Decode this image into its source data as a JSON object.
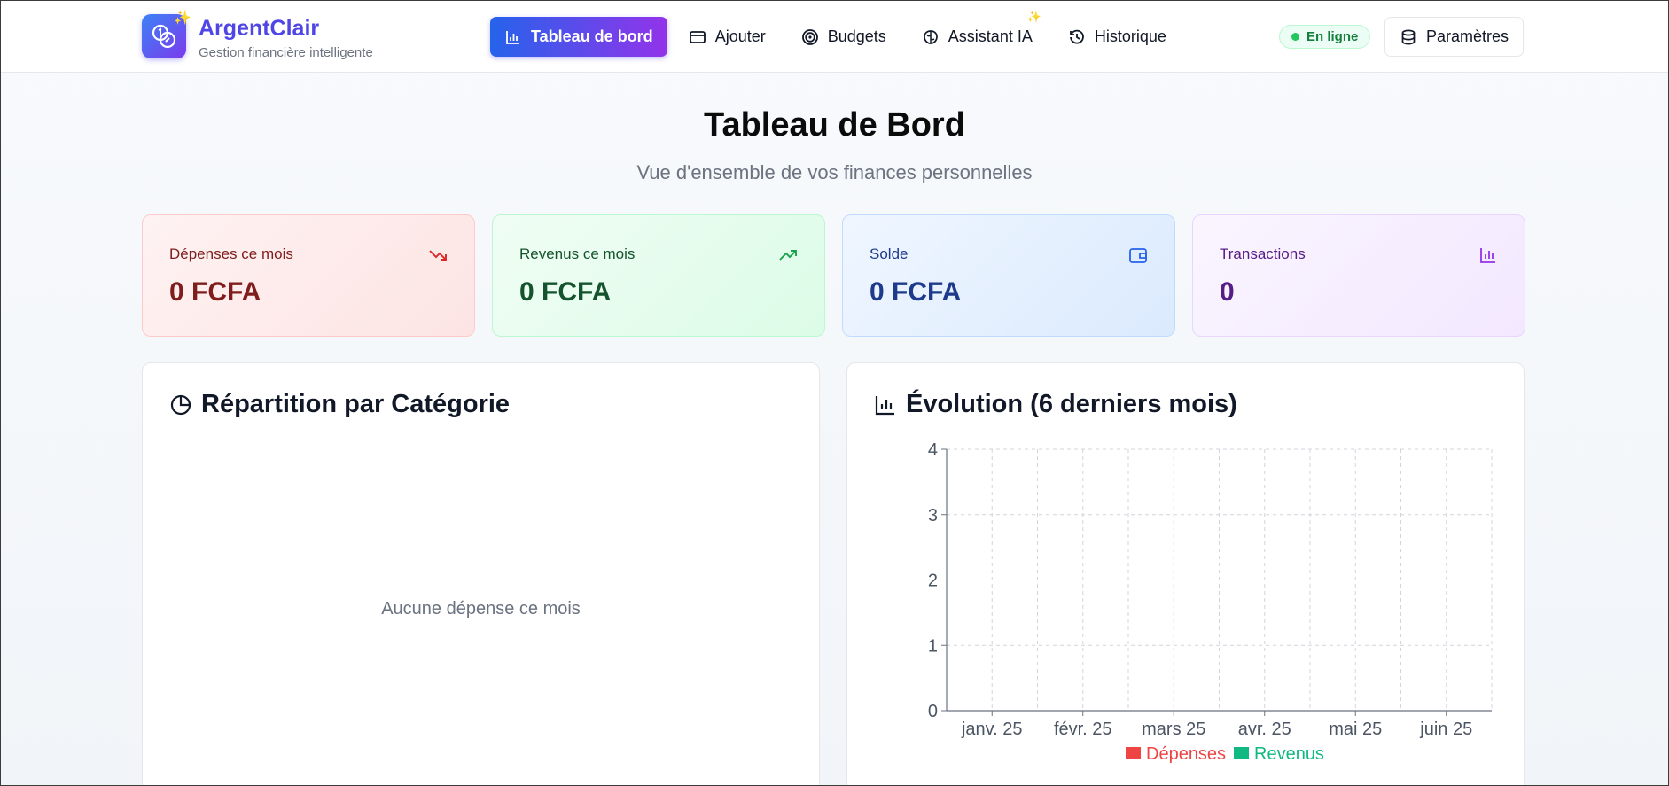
{
  "app": {
    "name": "ArgentClair",
    "subtitle": "Gestion financière intelligente"
  },
  "nav": {
    "items": [
      {
        "label": "Tableau de bord",
        "icon": "bar-chart-icon",
        "active": true
      },
      {
        "label": "Ajouter",
        "icon": "credit-card-icon",
        "active": false
      },
      {
        "label": "Budgets",
        "icon": "target-icon",
        "active": false
      },
      {
        "label": "Assistant IA",
        "icon": "brain-icon",
        "active": false,
        "badge": "sparkle-icon"
      },
      {
        "label": "Historique",
        "icon": "history-icon",
        "active": false
      }
    ]
  },
  "status": {
    "label": "En ligne",
    "color": "#22c55e"
  },
  "settings": {
    "label": "Paramètres",
    "icon": "database-icon"
  },
  "page": {
    "title": "Tableau de Bord",
    "subtitle": "Vue d'ensemble de vos finances personnelles"
  },
  "stats": [
    {
      "label": "Dépenses ce mois",
      "value": "0 FCFA",
      "icon": "trending-down-icon",
      "color": "#dc2626"
    },
    {
      "label": "Revenus ce mois",
      "value": "0 FCFA",
      "icon": "trending-up-icon",
      "color": "#16a34a"
    },
    {
      "label": "Solde",
      "value": "0 FCFA",
      "icon": "wallet-icon",
      "color": "#2563eb"
    },
    {
      "label": "Transactions",
      "value": "0",
      "icon": "bar-chart-icon",
      "color": "#9333ea"
    }
  ],
  "category_panel": {
    "title": "Répartition par Catégorie",
    "icon": "pie-chart-icon",
    "empty_message": "Aucune dépense ce mois"
  },
  "evolution_panel": {
    "title": "Évolution (6 derniers mois)",
    "icon": "bar-chart-icon"
  },
  "chart_data": {
    "type": "bar",
    "categories": [
      "janv. 25",
      "févr. 25",
      "mars 25",
      "avr. 25",
      "mai 25",
      "juin 25"
    ],
    "series": [
      {
        "name": "Dépenses",
        "values": [
          0,
          0,
          0,
          0,
          0,
          0
        ],
        "color": "#ef4444"
      },
      {
        "name": "Revenus",
        "values": [
          0,
          0,
          0,
          0,
          0,
          0
        ],
        "color": "#10b981"
      }
    ],
    "yticks": [
      0,
      1,
      2,
      3,
      4
    ],
    "ylim": [
      0,
      4
    ],
    "grid": true,
    "legend": "bottom"
  }
}
